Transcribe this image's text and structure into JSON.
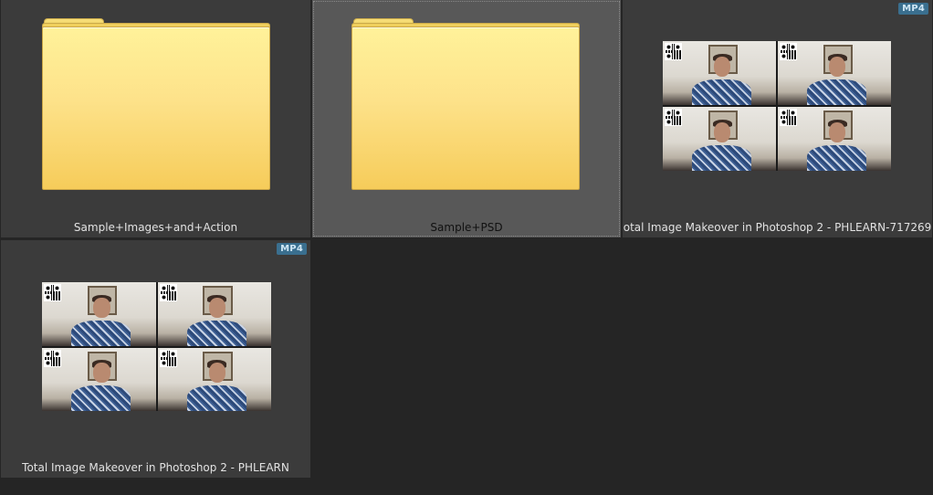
{
  "items": [
    {
      "name": "Sample+Images+and+Action",
      "type": "folder",
      "icon": "folder-icon",
      "selected": false
    },
    {
      "name": "Sample+PSD",
      "type": "folder",
      "icon": "folder-icon",
      "selected": true
    },
    {
      "name": "otal Image Makeover in Photoshop 2 - PHLEARN-717269",
      "type": "video",
      "badge": "MP4",
      "icon": "video-thumbnail"
    },
    {
      "name": "Total Image Makeover in Photoshop 2 - PHLEARN",
      "type": "video",
      "badge": "MP4",
      "icon": "video-thumbnail"
    }
  ],
  "colors": {
    "background": "#252525",
    "tile": "#3b3b3b",
    "tile_selected": "#585858",
    "badge": "#3a6f8f",
    "folder": "#fde28a"
  }
}
